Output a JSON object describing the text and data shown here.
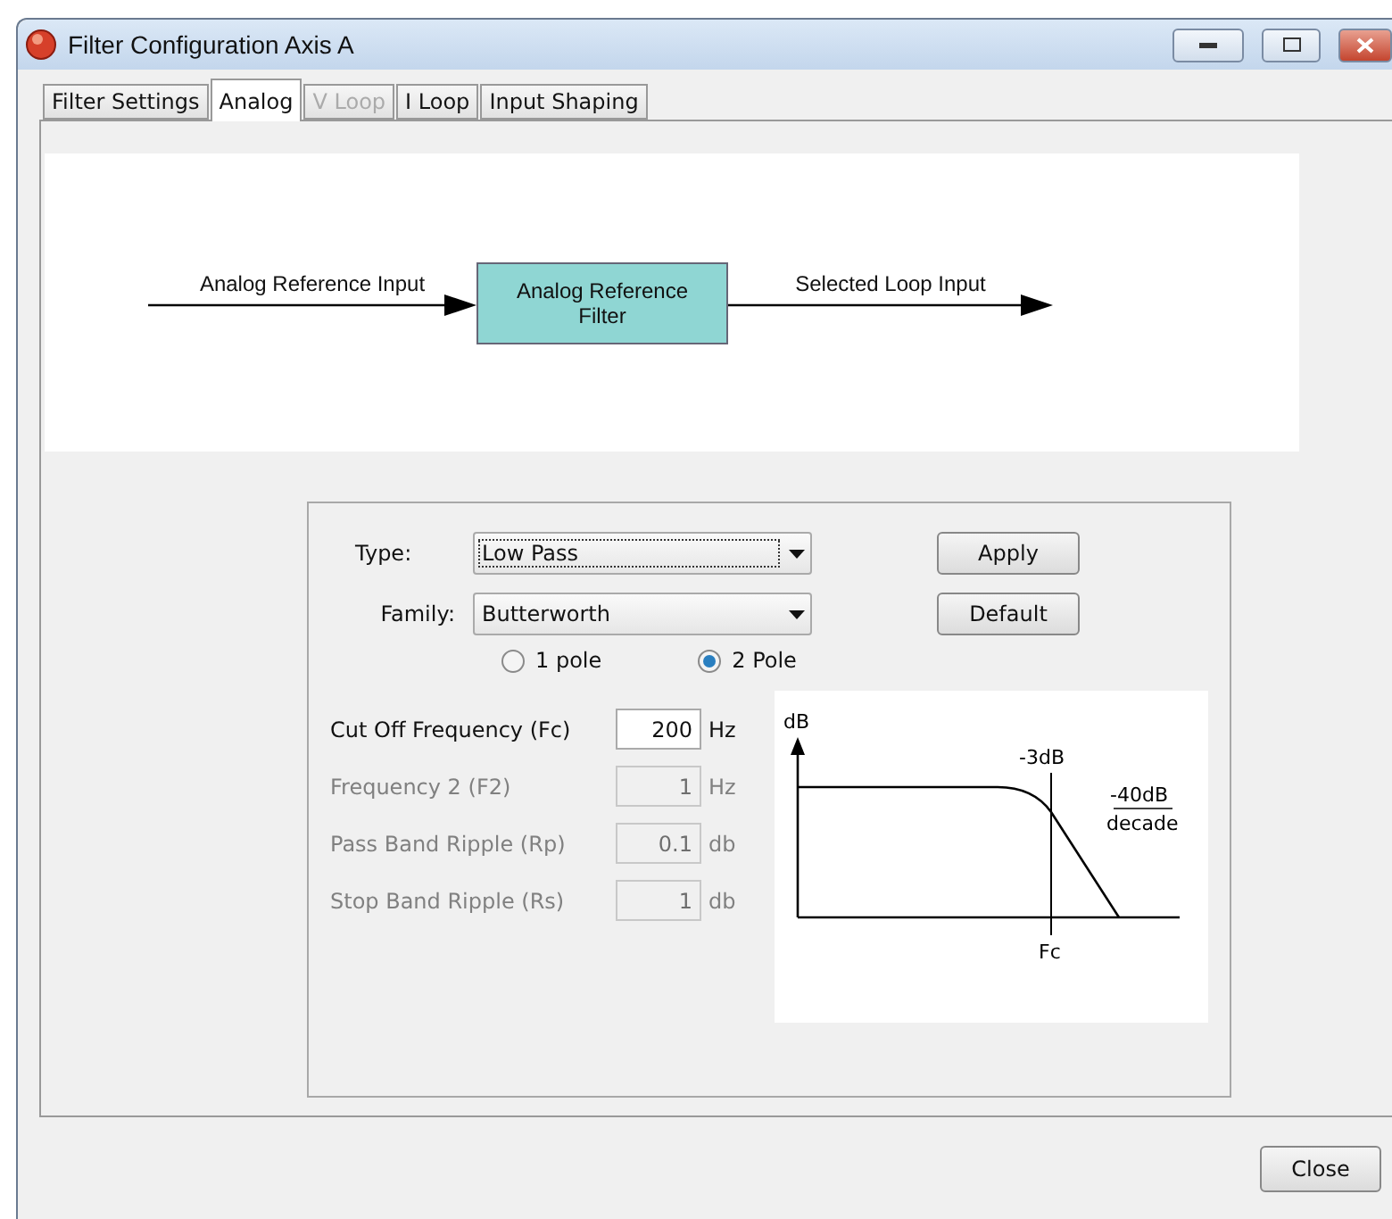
{
  "window": {
    "title": "Filter Configuration Axis A"
  },
  "tabs": [
    {
      "label": "Filter Settings",
      "selected": false,
      "disabled": false
    },
    {
      "label": "Analog",
      "selected": true,
      "disabled": false
    },
    {
      "label": "V Loop",
      "selected": false,
      "disabled": true
    },
    {
      "label": "I Loop",
      "selected": false,
      "disabled": false
    },
    {
      "label": "Input Shaping",
      "selected": false,
      "disabled": false
    }
  ],
  "diagram": {
    "input_label": "Analog Reference Input",
    "block_label": "Analog Reference Filter",
    "output_label": "Selected Loop Input"
  },
  "filter": {
    "type": {
      "label": "Type:",
      "value": "Low Pass",
      "focused": true
    },
    "family": {
      "label": "Family:",
      "value": "Butterworth",
      "focused": false
    },
    "poles": [
      {
        "label": "1 pole",
        "selected": false
      },
      {
        "label": "2 Pole",
        "selected": true
      }
    ],
    "buttons": [
      "Apply",
      "Default"
    ],
    "params": [
      {
        "label": "Cut Off Frequency (Fc)",
        "value": "200",
        "unit": "Hz",
        "disabled": false
      },
      {
        "label": "Frequency 2  (F2)",
        "value": "1",
        "unit": "Hz",
        "disabled": true
      },
      {
        "label": "Pass Band Ripple (Rp)",
        "value": "0.1",
        "unit": "db",
        "disabled": true
      },
      {
        "label": "Stop Band Ripple (Rs)",
        "value": "1",
        "unit": "db",
        "disabled": true
      }
    ],
    "response_graph": {
      "y_label": "dB",
      "corner_label": "-3dB",
      "slope_numerator": "-40dB",
      "slope_denominator": "decade",
      "x_label": "Fc"
    }
  },
  "close_button": "Close"
}
